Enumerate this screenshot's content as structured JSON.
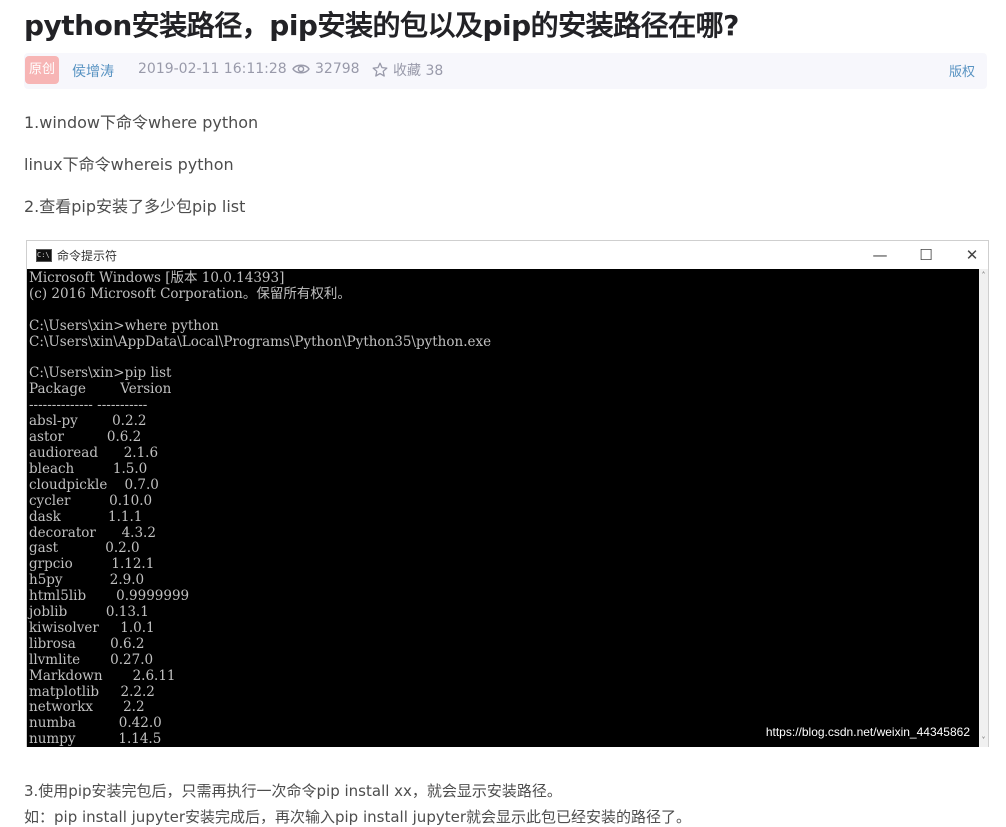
{
  "article": {
    "title": "python安装路径，pip安装的包以及pip的安装路径在哪?",
    "meta": {
      "badge": "原创",
      "author": "侯增涛",
      "date": "2019-02-11 16:11:28",
      "views": "32798",
      "favorites": "收藏 38",
      "rights": "版权"
    },
    "paragraphs": [
      "1.window下命令where python",
      "linux下命令whereis python",
      "2.查看pip安装了多少包pip list"
    ],
    "footer_lines": [
      "3.使用pip安装完包后，只需再执行一次命令pip install xx，就会显示安装路径。",
      "如：pip install jupyter安装完成后，再次输入pip install jupyter就会显示此包已经安装的路径了。"
    ]
  },
  "screenshot": {
    "window_title": "命令提示符",
    "icon": "cmd-icon",
    "buttons": {
      "minimize": "—",
      "maximize": "☐",
      "close": "✕"
    },
    "console_lines": [
      "Microsoft Windows [版本 10.0.14393]",
      "(c) 2016 Microsoft Corporation。保留所有权利。",
      "",
      "C:\\Users\\xin>where python",
      "C:\\Users\\xin\\AppData\\Local\\Programs\\Python\\Python35\\python.exe",
      "",
      "C:\\Users\\xin>pip list",
      "Package        Version",
      "-------------- -----------",
      "absl-py        0.2.2",
      "astor          0.6.2",
      "audioread      2.1.6",
      "bleach         1.5.0",
      "cloudpickle    0.7.0",
      "cycler         0.10.0",
      "dask           1.1.1",
      "decorator      4.3.2",
      "gast           0.2.0",
      "grpcio         1.12.1",
      "h5py           2.9.0",
      "html5lib       0.9999999",
      "joblib         0.13.1",
      "kiwisolver     1.0.1",
      "librosa        0.6.2",
      "llvmlite       0.27.0",
      "Markdown       2.6.11",
      "matplotlib     2.2.2",
      "networkx       2.2",
      "numba          0.42.0",
      "numpy          1.14.5"
    ],
    "watermark": "https://blog.csdn.net/weixin_44345862"
  },
  "colors": {
    "badge_bg": "#f7b5b5",
    "link": "#5893c2",
    "meta_text": "#999aaa",
    "console_bg": "#000000",
    "console_text": "#c0c0c0"
  }
}
